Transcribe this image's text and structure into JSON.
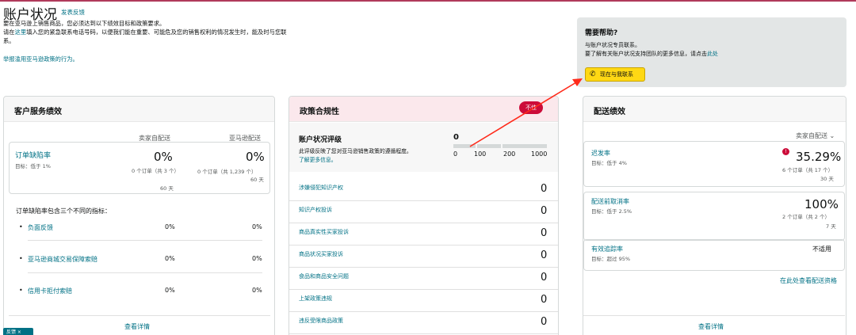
{
  "page": {
    "title": "账户状况",
    "feedback": "发表反馈",
    "intro1": "要在亚马逊上销售商品，您必须达到以下绩效目标和政策要求。",
    "intro2a": "请在",
    "intro2link": "这里",
    "intro2b": "填入您的紧急联系电话号码，以便我们能在重要、可能危及您的销售权利的情况发生时，能及时与您联系。",
    "report": "举报滥用亚马逊政策的行为。",
    "chip": "反馈 ×"
  },
  "help": {
    "title": "需要帮助?",
    "line1": "与账户状况专员联系。",
    "line2a": "要了解有关账户状况支持团队的更多信息，请点击",
    "line2link": "此处",
    "button": "现在与我联系"
  },
  "customer": {
    "title": "客户服务绩效",
    "col1": "卖家自配送",
    "col2": "亚马逊配送",
    "odr": {
      "label": "订单缺陷率",
      "target": "目标：低于 1%",
      "v1": "0%",
      "v1sub": "0 个订单（共 3 个）",
      "v1days": "60 天",
      "v2": "0%",
      "v2sub": "0 个订单（共 1,239 个）",
      "v2days": "60 天"
    },
    "note": "订单缺陷率包含三个不同的指标：",
    "metrics": [
      {
        "label": "负面反馈",
        "v1": "0%",
        "v2": "0%"
      },
      {
        "label": "亚马逊商城交易保障索赔",
        "v1": "0%",
        "v2": "0%"
      },
      {
        "label": "信用卡拒付索赔",
        "v1": "0%",
        "v2": "0%"
      }
    ],
    "details": "查看详情"
  },
  "policy": {
    "title": "政策合规性",
    "badge": "不佳",
    "rating_title": "账户状况评级",
    "rating_desc": "此评级反映了您对亚马逊销售政策的遵循程度。",
    "rating_link": "了解更多信息。",
    "score": "0",
    "scale": [
      "0",
      "100",
      "200",
      "1000"
    ],
    "items": [
      {
        "label": "涉嫌侵犯知识产权",
        "count": "0"
      },
      {
        "label": "知识产权投诉",
        "count": "0"
      },
      {
        "label": "商品真实性买家投诉",
        "count": "0"
      },
      {
        "label": "商品状况买家投诉",
        "count": "0"
      },
      {
        "label": "食品和商品安全问题",
        "count": "0"
      },
      {
        "label": "上架政策违规",
        "count": "0"
      },
      {
        "label": "违反受限商品政策",
        "count": "0"
      }
    ]
  },
  "shipping": {
    "title": "配送绩效",
    "filter": "卖家自配送",
    "late": {
      "label": "迟发率",
      "target": "目标：低于 4%",
      "value": "35.29%",
      "sub": "6 个订单（共 17 个）",
      "days": "30 天"
    },
    "cancel": {
      "label": "配送前取消率",
      "target": "目标：低于 2.5%",
      "value": "100%",
      "sub": "2 个订单（共 2 个）",
      "days": "7 天"
    },
    "tracking": {
      "label": "有效追踪率",
      "target": "目标：超过 95%",
      "value": "不适用"
    },
    "eligibility": "在此处查看配送资格",
    "details": "查看详情"
  }
}
